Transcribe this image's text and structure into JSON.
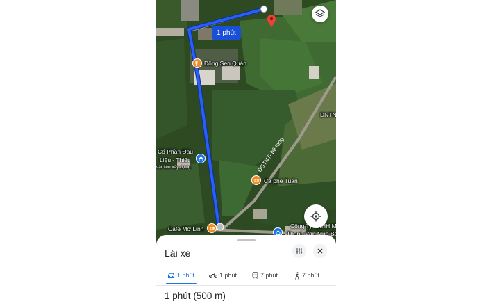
{
  "map": {
    "route_label": "1 phút",
    "pois": {
      "dong_sen": "Đồng Sen Quán",
      "co_phan_line1": "Cổ Phần Đầu",
      "co_phan_line2": "Liệu - Thiết",
      "co_phan_line3": "vật liệu xây dựng",
      "ca_phe_tuan": "Cà phê Tuấn",
      "cafe_mo_linh": "Cafe Mơ Linh",
      "cong_ty_line1": "Công Ty TNHH Mộ",
      "cong_ty_line2": "Thanh Vân Mua Bá",
      "road_label": "ĐGTNT- bê tông",
      "edge_label": "DNTN"
    }
  },
  "sheet": {
    "title": "Lái xe",
    "tabs": [
      {
        "label": "1 phút",
        "icon": "car-icon",
        "active": true
      },
      {
        "label": "1 phút",
        "icon": "motorbike-icon",
        "active": false
      },
      {
        "label": "7 phút",
        "icon": "transit-icon",
        "active": false
      },
      {
        "label": "7 phút",
        "icon": "walking-icon",
        "active": false
      }
    ],
    "summary_time": "1 phút",
    "summary_distance": "(500 m)"
  },
  "colors": {
    "route": "#1a4fd8",
    "accent": "#1a73e8",
    "destination_pin": "#ea4335",
    "food_pin": "#f28b22"
  }
}
